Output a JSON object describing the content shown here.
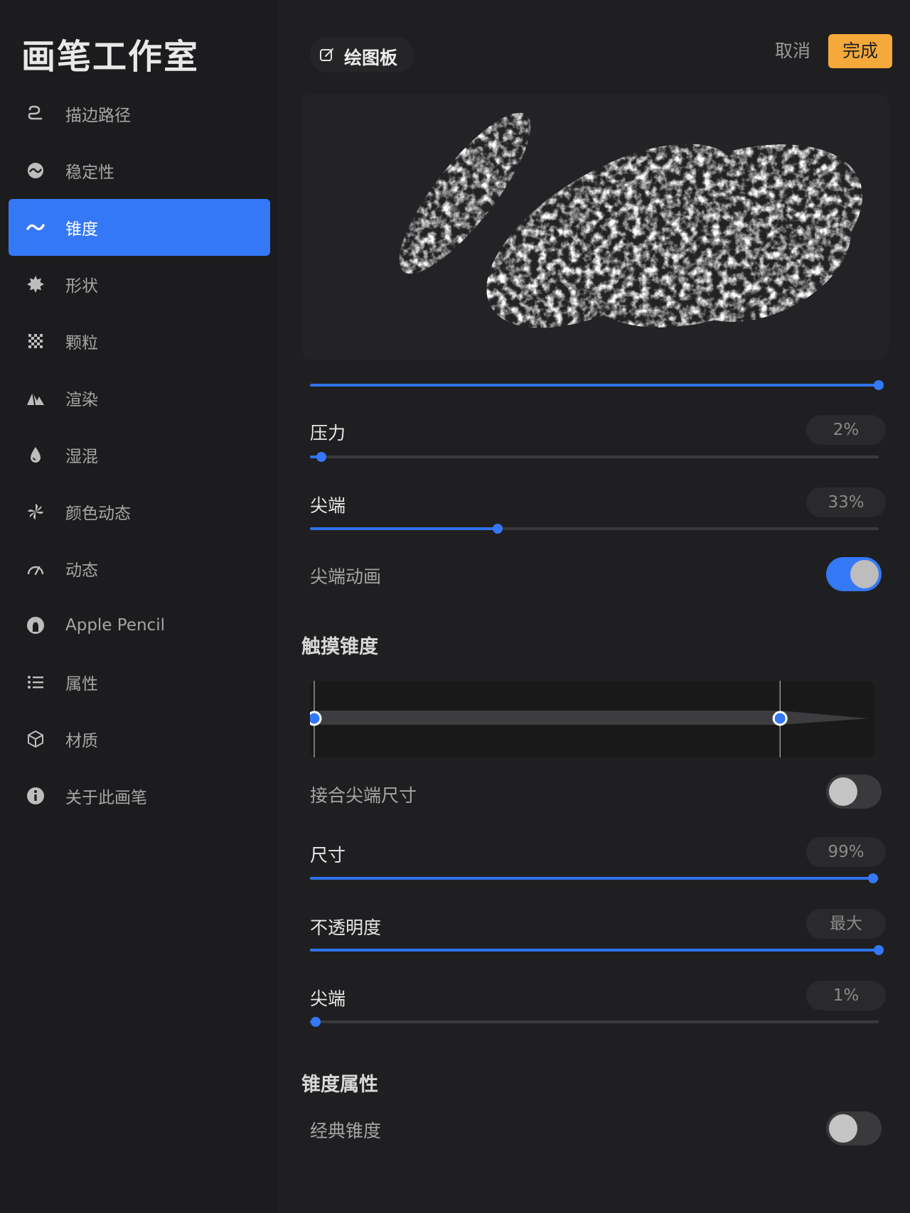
{
  "sidebar": {
    "title": "画笔工作室",
    "items": [
      {
        "label": "描边路径",
        "icon": "stroke-path-icon",
        "active": false
      },
      {
        "label": "稳定性",
        "icon": "stabilization-icon",
        "active": false
      },
      {
        "label": "锥度",
        "icon": "taper-icon",
        "active": true
      },
      {
        "label": "形状",
        "icon": "shape-icon",
        "active": false
      },
      {
        "label": "颗粒",
        "icon": "grain-icon",
        "active": false
      },
      {
        "label": "渲染",
        "icon": "rendering-icon",
        "active": false
      },
      {
        "label": "湿混",
        "icon": "wet-mix-icon",
        "active": false
      },
      {
        "label": "颜色动态",
        "icon": "color-dynamics-icon",
        "active": false
      },
      {
        "label": "动态",
        "icon": "dynamics-icon",
        "active": false
      },
      {
        "label": "Apple Pencil",
        "icon": "apple-pencil-icon",
        "active": false
      },
      {
        "label": "属性",
        "icon": "properties-icon",
        "active": false
      },
      {
        "label": "材质",
        "icon": "materials-icon",
        "active": false
      },
      {
        "label": "关于此画笔",
        "icon": "info-icon",
        "active": false
      }
    ]
  },
  "header": {
    "drawpad_label": "绘图板",
    "cancel_label": "取消",
    "done_label": "完成"
  },
  "colors": {
    "accent": "#3478f6",
    "done": "#f5a93b",
    "background": "#1c1c1e"
  },
  "preview": {
    "slider_value": 1.0
  },
  "pressure_taper": {
    "pressure": {
      "label": "压力",
      "value": "2%",
      "fraction": 0.02
    },
    "tip": {
      "label": "尖端",
      "value": "33%",
      "fraction": 0.33
    },
    "tip_animation": {
      "label": "尖端动画",
      "on": true
    }
  },
  "touch_taper": {
    "title": "触摸锥度",
    "start": 0.0,
    "end": 0.84,
    "link_tip_size": {
      "label": "接合尖端尺寸",
      "on": false
    },
    "size": {
      "label": "尺寸",
      "value": "99%",
      "fraction": 0.99
    },
    "opacity": {
      "label": "不透明度",
      "value": "最大",
      "fraction": 1.0
    },
    "tip": {
      "label": "尖端",
      "value": "1%",
      "fraction": 0.01
    }
  },
  "taper_properties": {
    "title": "锥度属性",
    "classic_taper": {
      "label": "经典锥度",
      "on": false
    }
  }
}
